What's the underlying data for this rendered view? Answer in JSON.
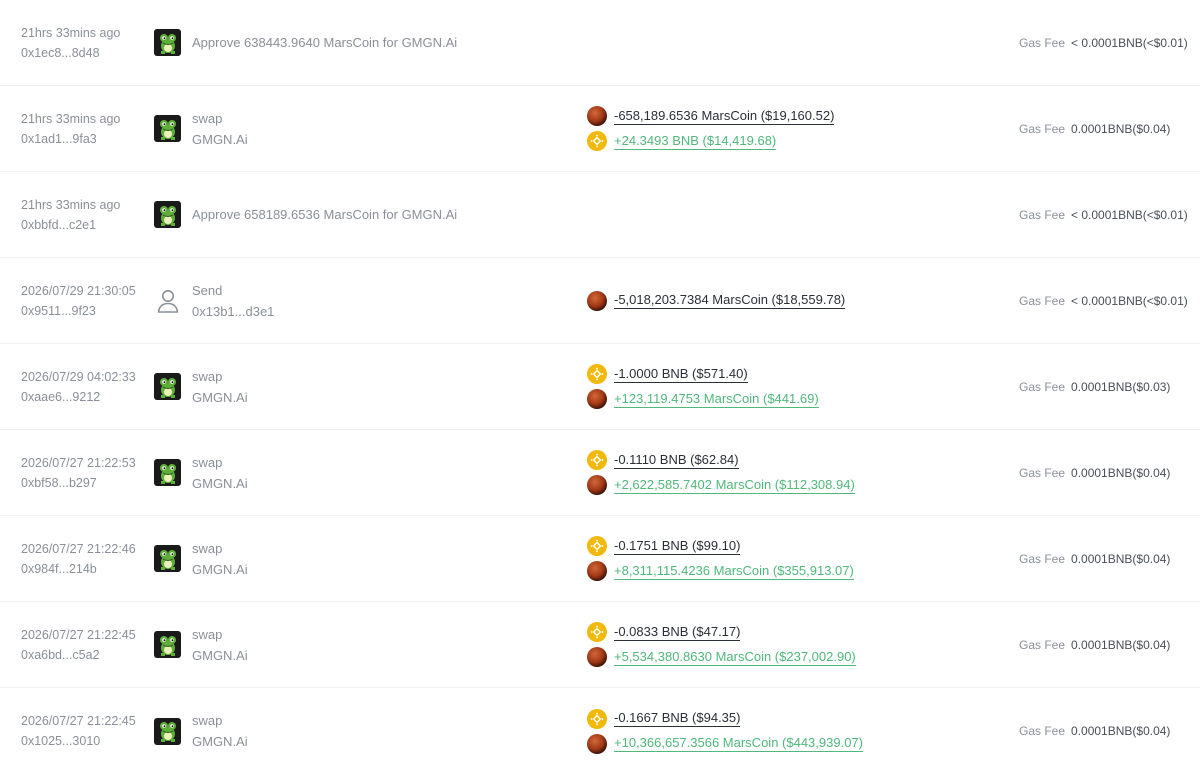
{
  "colors": {
    "positive": "#4fb87a",
    "negative": "#2b2f36",
    "muted": "#8a8f98",
    "bnb": "#f0b90b"
  },
  "rows": [
    {
      "time": "21hrs 33mins ago",
      "hash": "0x1ec8...8d48",
      "avatar": "frog-avatar",
      "action_main": "Approve 638443.9640 MarsCoin for GMGN.Ai",
      "action_sub": "",
      "amounts": [],
      "gas_label": "Gas Fee",
      "gas_value": "< 0.0001BNB(<$0.01)"
    },
    {
      "time": "21hrs 33mins ago",
      "hash": "0x1ad1...9fa3",
      "avatar": "frog-avatar",
      "action_main": "swap",
      "action_sub": "GMGN.Ai",
      "amounts": [
        {
          "token": "mars",
          "text": "-658,189.6536 MarsCoin ($19,160.52)",
          "sign": "neg"
        },
        {
          "token": "bnb",
          "text": "+24.3493 BNB ($14,419.68)",
          "sign": "pos"
        }
      ],
      "gas_label": "Gas Fee",
      "gas_value": "0.0001BNB($0.04)"
    },
    {
      "time": "21hrs 33mins ago",
      "hash": "0xbbfd...c2e1",
      "avatar": "frog-avatar",
      "action_main": "Approve 658189.6536 MarsCoin for GMGN.Ai",
      "action_sub": "",
      "amounts": [],
      "gas_label": "Gas Fee",
      "gas_value": "< 0.0001BNB(<$0.01)"
    },
    {
      "time": "2026/07/29 21:30:05",
      "hash": "0x9511...9f23",
      "avatar": "person-icon",
      "action_main": "Send",
      "action_sub": "0x13b1...d3e1",
      "amounts": [
        {
          "token": "mars",
          "text": "-5,018,203.7384 MarsCoin ($18,559.78)",
          "sign": "neg"
        }
      ],
      "gas_label": "Gas Fee",
      "gas_value": "< 0.0001BNB(<$0.01)"
    },
    {
      "time": "2026/07/29 04:02:33",
      "hash": "0xaae6...9212",
      "avatar": "frog-avatar",
      "action_main": "swap",
      "action_sub": "GMGN.Ai",
      "amounts": [
        {
          "token": "bnb",
          "text": "-1.0000 BNB ($571.40)",
          "sign": "neg"
        },
        {
          "token": "mars",
          "text": "+123,119.4753 MarsCoin ($441.69)",
          "sign": "pos"
        }
      ],
      "gas_label": "Gas Fee",
      "gas_value": "0.0001BNB($0.03)"
    },
    {
      "time": "2026/07/27 21:22:53",
      "hash": "0xbf58...b297",
      "avatar": "frog-avatar",
      "action_main": "swap",
      "action_sub": "GMGN.Ai",
      "amounts": [
        {
          "token": "bnb",
          "text": "-0.1110 BNB ($62.84)",
          "sign": "neg"
        },
        {
          "token": "mars",
          "text": "+2,622,585.7402 MarsCoin ($112,308.94)",
          "sign": "pos"
        }
      ],
      "gas_label": "Gas Fee",
      "gas_value": "0.0001BNB($0.04)"
    },
    {
      "time": "2026/07/27 21:22:46",
      "hash": "0x984f...214b",
      "avatar": "frog-avatar",
      "action_main": "swap",
      "action_sub": "GMGN.Ai",
      "amounts": [
        {
          "token": "bnb",
          "text": "-0.1751 BNB ($99.10)",
          "sign": "neg"
        },
        {
          "token": "mars",
          "text": "+8,311,115.4236 MarsCoin ($355,913.07)",
          "sign": "pos"
        }
      ],
      "gas_label": "Gas Fee",
      "gas_value": "0.0001BNB($0.04)"
    },
    {
      "time": "2026/07/27 21:22:45",
      "hash": "0xa6bd...c5a2",
      "avatar": "frog-avatar",
      "action_main": "swap",
      "action_sub": "GMGN.Ai",
      "amounts": [
        {
          "token": "bnb",
          "text": "-0.0833 BNB ($47.17)",
          "sign": "neg"
        },
        {
          "token": "mars",
          "text": "+5,534,380.8630 MarsCoin ($237,002.90)",
          "sign": "pos"
        }
      ],
      "gas_label": "Gas Fee",
      "gas_value": "0.0001BNB($0.04)"
    },
    {
      "time": "2026/07/27 21:22:45",
      "hash": "0x1025...3010",
      "avatar": "frog-avatar",
      "action_main": "swap",
      "action_sub": "GMGN.Ai",
      "amounts": [
        {
          "token": "bnb",
          "text": "-0.1667 BNB ($94.35)",
          "sign": "neg"
        },
        {
          "token": "mars",
          "text": "+10,366,657.3566 MarsCoin ($443,939.07)",
          "sign": "pos"
        }
      ],
      "gas_label": "Gas Fee",
      "gas_value": "0.0001BNB($0.04)"
    }
  ]
}
